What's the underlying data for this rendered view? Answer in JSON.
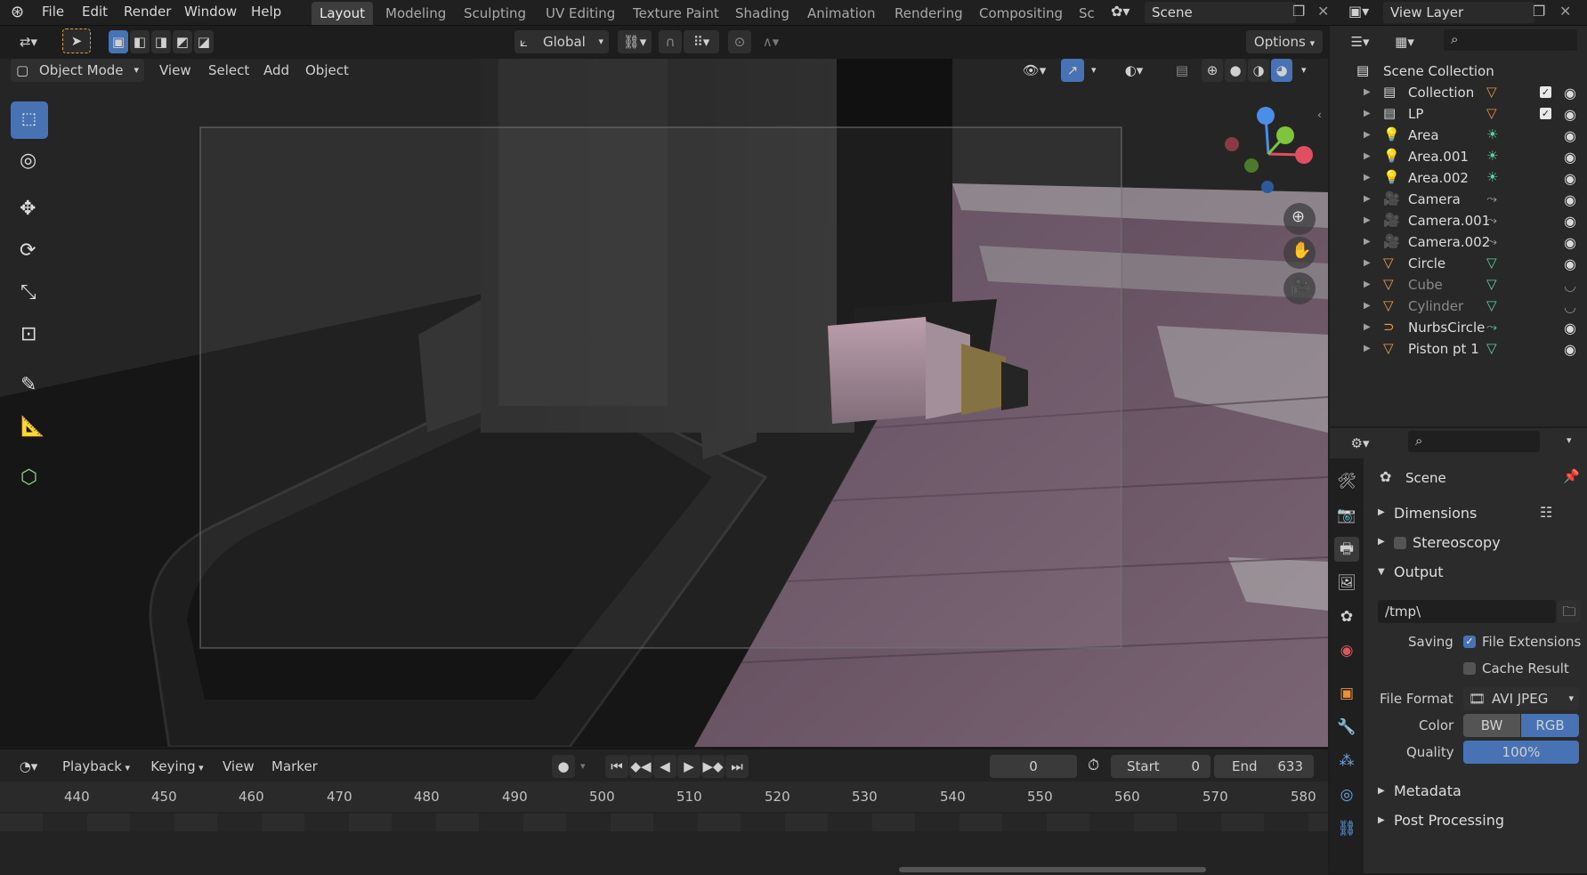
{
  "topbar": {
    "menus": [
      "File",
      "Edit",
      "Render",
      "Window",
      "Help"
    ],
    "workspaces": [
      "Layout",
      "Modeling",
      "Sculpting",
      "UV Editing",
      "Texture Paint",
      "Shading",
      "Animation",
      "Rendering",
      "Compositing",
      "Sc"
    ],
    "active_workspace": "Layout",
    "scene_name": "Scene",
    "view_layer": "View Layer"
  },
  "viewport_header": {
    "transform_orientation": "Global",
    "options_label": "Options",
    "mode": "Object Mode",
    "menus": [
      "View",
      "Select",
      "Add",
      "Object"
    ]
  },
  "timeline": {
    "menus": [
      "Playback",
      "Keying",
      "View",
      "Marker"
    ],
    "current_frame": "0",
    "start_label": "Start",
    "start_value": "0",
    "end_label": "End",
    "end_value": "633",
    "ruler": [
      "440",
      "450",
      "460",
      "470",
      "480",
      "490",
      "500",
      "510",
      "520",
      "530",
      "540",
      "550",
      "560",
      "570",
      "580"
    ]
  },
  "outliner": {
    "root": "Scene Collection",
    "items": [
      {
        "name": "Collection",
        "kind": "collection",
        "dim": false
      },
      {
        "name": "LP",
        "kind": "collection",
        "dim": false
      },
      {
        "name": "Area",
        "kind": "light",
        "dim": false
      },
      {
        "name": "Area.001",
        "kind": "light",
        "dim": false
      },
      {
        "name": "Area.002",
        "kind": "light",
        "dim": false
      },
      {
        "name": "Camera",
        "kind": "camera",
        "dim": false
      },
      {
        "name": "Camera.001",
        "kind": "camera",
        "dim": false
      },
      {
        "name": "Camera.002",
        "kind": "camera",
        "dim": false
      },
      {
        "name": "Circle",
        "kind": "mesh",
        "dim": false
      },
      {
        "name": "Cube",
        "kind": "mesh",
        "dim": true
      },
      {
        "name": "Cylinder",
        "kind": "mesh",
        "dim": true
      },
      {
        "name": "NurbsCircle",
        "kind": "curve",
        "dim": false
      },
      {
        "name": "Piston pt 1",
        "kind": "mesh",
        "dim": false
      }
    ]
  },
  "properties": {
    "context": "Scene",
    "sections": {
      "dimensions": "Dimensions",
      "stereoscopy": "Stereoscopy",
      "output": "Output",
      "metadata": "Metadata",
      "post_processing": "Post Processing"
    },
    "output_path": "/tmp\\",
    "saving_label": "Saving",
    "file_extensions": "File Extensions",
    "cache_result": "Cache Result",
    "file_format_label": "File Format",
    "file_format": "AVI JPEG",
    "color_label": "Color",
    "color_bw": "BW",
    "color_rgb": "RGB",
    "quality_label": "Quality",
    "quality_value": "100%"
  },
  "colors": {
    "accent": "#4772b3",
    "background": "#1d1d1d",
    "panel": "#2b2b2b"
  }
}
